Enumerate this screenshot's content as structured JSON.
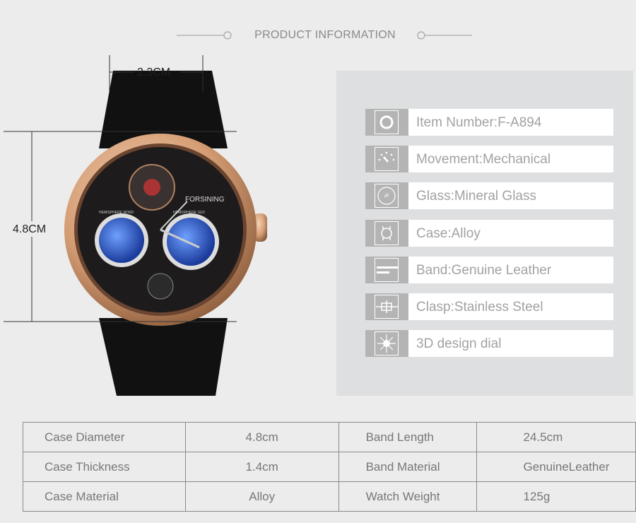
{
  "header": {
    "title": "PRODUCT INFORMATION"
  },
  "dimensions": {
    "width_label": "2.3CM",
    "height_label": "4.8CM"
  },
  "watch": {
    "brand": "FORSINING",
    "subdial_left": "HEMISPHERE NORD",
    "subdial_right": "HEMISPHERE SUD"
  },
  "features": [
    {
      "icon": "watch-case-icon",
      "text": "Item Number:F-A894"
    },
    {
      "icon": "gauge-icon",
      "text": "Movement:Mechanical"
    },
    {
      "icon": "glass-icon",
      "text": "Glass:Mineral Glass"
    },
    {
      "icon": "case-icon",
      "text": "Case:Alloy"
    },
    {
      "icon": "band-icon",
      "text": "Band:Genuine Leather"
    },
    {
      "icon": "clasp-icon",
      "text": "Clasp:Stainless Steel"
    },
    {
      "icon": "sun-icon",
      "text": "3D design dial"
    }
  ],
  "specs": [
    [
      "Case Diameter",
      "4.8cm",
      "Band Length",
      "24.5cm"
    ],
    [
      "Case Thickness",
      "1.4cm",
      "Band Material",
      "GenuineLeather"
    ],
    [
      "Case Material",
      "Alloy",
      "Watch Weight",
      "125g"
    ]
  ],
  "colors": {
    "background": "#ececec",
    "panel": "#dedfe0",
    "icon_bg": "#b4b4b4",
    "rose_gold": "#d9a57c"
  }
}
